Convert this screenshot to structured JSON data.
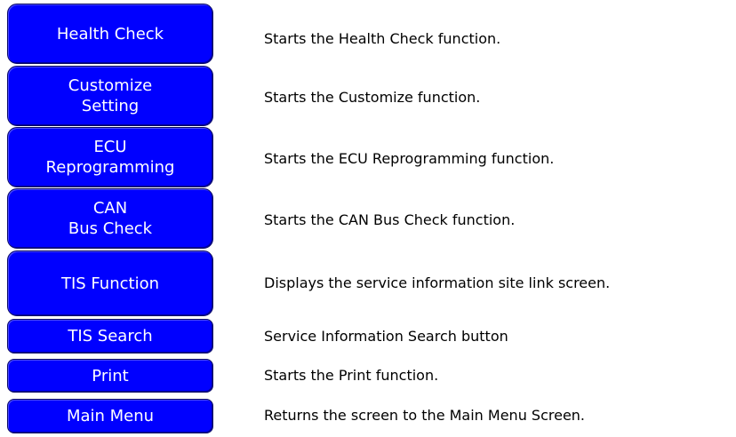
{
  "rows": [
    {
      "button": [
        "Health Check"
      ],
      "description": "Starts the Health Check function."
    },
    {
      "button": [
        "Customize",
        "Setting"
      ],
      "description": "Starts the Customize function."
    },
    {
      "button": [
        "ECU",
        "Reprogramming"
      ],
      "description": "Starts the ECU Reprogramming function."
    },
    {
      "button": [
        "CAN",
        "Bus Check"
      ],
      "description": "Starts the CAN Bus Check function."
    },
    {
      "button": [
        "TIS Function"
      ],
      "description": "Displays the service information site link screen."
    },
    {
      "button": [
        "TIS Search"
      ],
      "description": "Service Information Search button"
    },
    {
      "button": [
        "Print"
      ],
      "description": "Starts the Print function."
    },
    {
      "button": [
        "Main Menu"
      ],
      "description": "Returns the screen to the Main Menu Screen."
    }
  ],
  "colors": {
    "button_fill": "#0000ff",
    "button_text": "#ffffff",
    "description_text": "#000000"
  }
}
